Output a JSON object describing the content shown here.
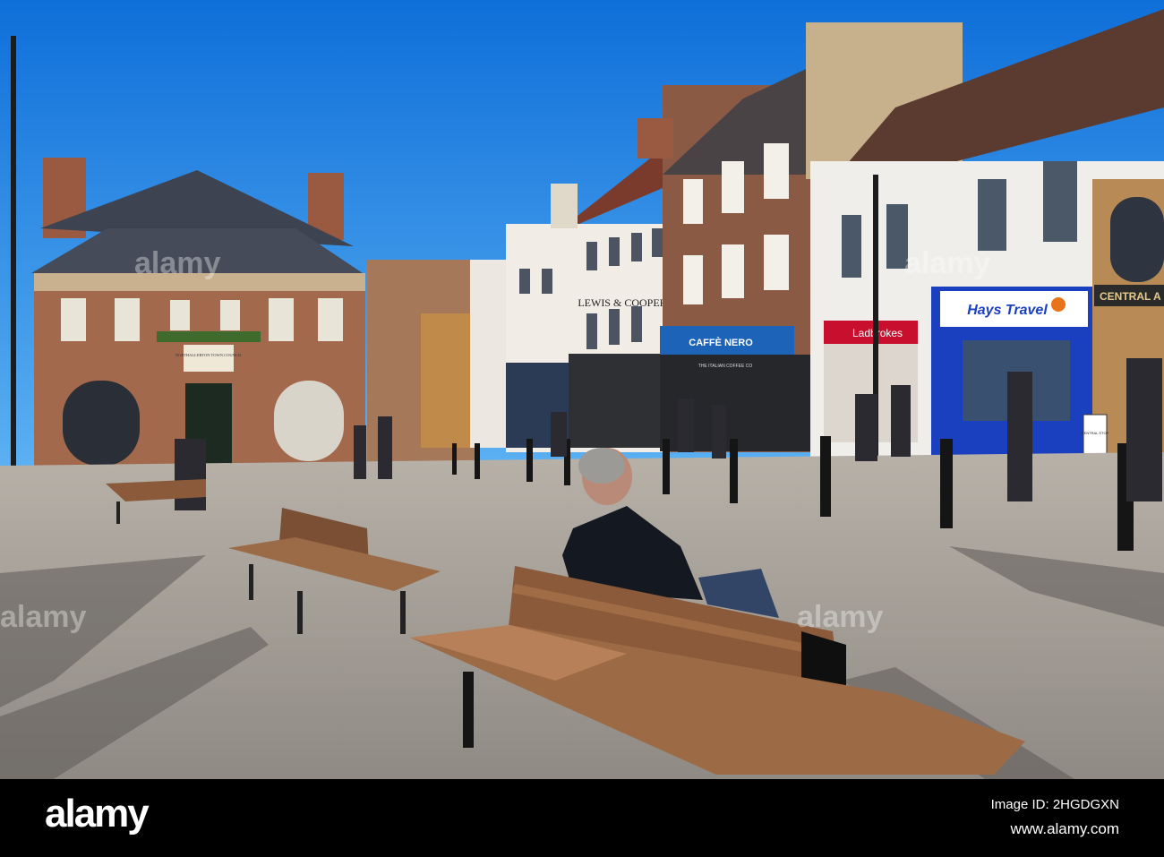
{
  "photo": {
    "signs": {
      "town_council": "NORTHALLERTON TOWN COUNCIL",
      "lewis_cooper": "LEWIS & COOPER",
      "caffe_nero": "CAFFÈ NERO",
      "ladbrokes": "Ladbrokes",
      "hays_travel": "Hays Travel",
      "central_arcade": "CENTRAL A",
      "italian_coffee": "THE ITALIAN COFFEE CO",
      "central_stop": "CENTRAL STOP"
    },
    "colors": {
      "sky": "#1f86e6",
      "brick": "#8c5a3f",
      "paving": "#a9a39a",
      "bench": "#8a5a3a",
      "hays_blue": "#1a3fbf"
    }
  },
  "watermark": {
    "logo": "alamy",
    "image_id": "Image ID: 2HGDGXN",
    "url": "www.alamy.com"
  }
}
